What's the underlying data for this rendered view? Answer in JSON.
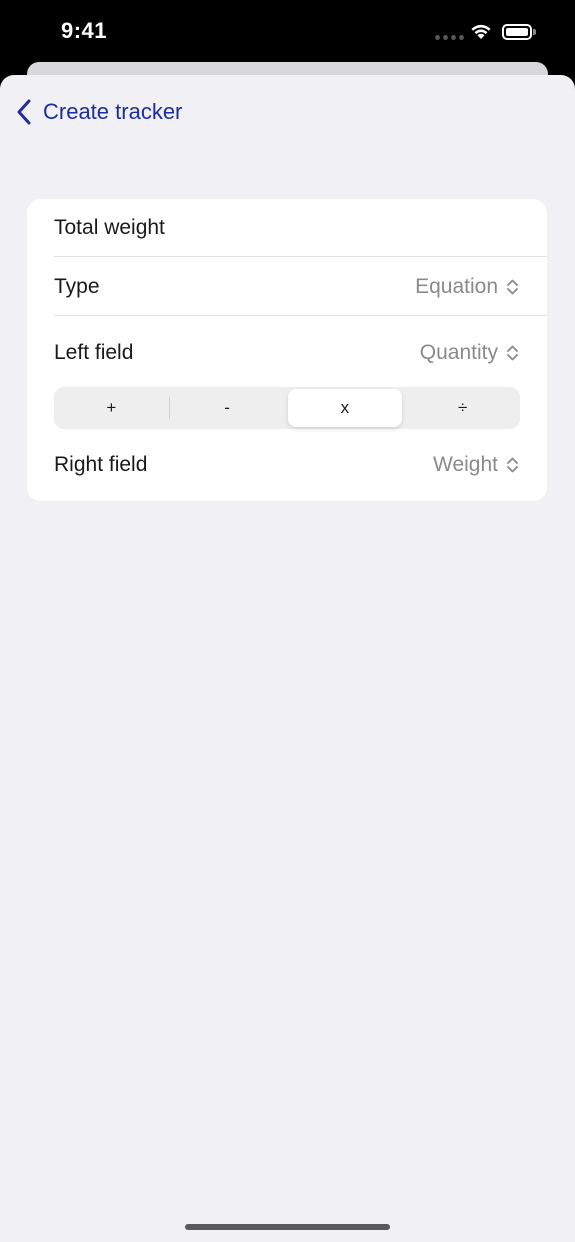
{
  "status_bar": {
    "time": "9:41",
    "icons": [
      "cellular-signal-icon",
      "wifi-icon",
      "battery-icon"
    ]
  },
  "nav": {
    "back_label": "Create tracker",
    "back_icon": "chevron-left-icon",
    "accent_color": "#1c2da0"
  },
  "form": {
    "name_value": "Total weight",
    "type": {
      "label": "Type",
      "value": "Equation"
    },
    "left_field": {
      "label": "Left field",
      "value": "Quantity"
    },
    "operator": {
      "options": [
        "+",
        "-",
        "x",
        "÷"
      ],
      "selected": "x"
    },
    "right_field": {
      "label": "Right field",
      "value": "Weight"
    }
  }
}
